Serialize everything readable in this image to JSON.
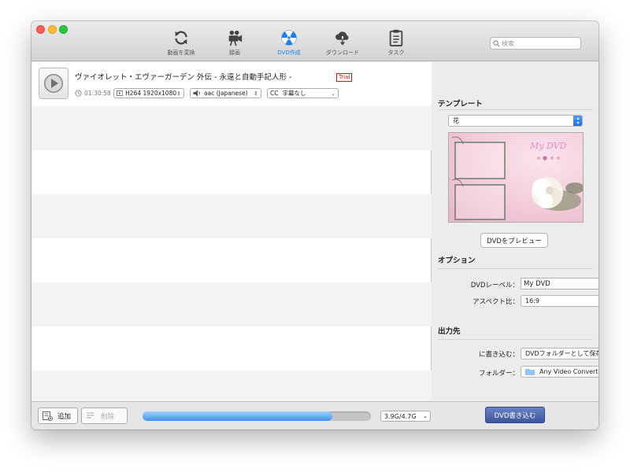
{
  "toolbar": {
    "items": [
      {
        "label": "動画を変換",
        "icon": "convert-icon"
      },
      {
        "label": "録画",
        "icon": "video-camera-icon"
      },
      {
        "label": "DVD作成",
        "icon": "radiation-icon"
      },
      {
        "label": "ダウンロード",
        "icon": "cloud-download-icon"
      },
      {
        "label": "タスク",
        "icon": "clipboard-icon"
      }
    ],
    "active_color": "#1f7ff0",
    "search_placeholder": "検索"
  },
  "video": {
    "title": "ヴァイオレット・エヴァーガーデン 外伝 - 永遠と自動手記人形 -",
    "trial_badge": "Trial",
    "duration": "01:30:58",
    "video_track": "H264 1920x1080",
    "audio_track": "aac (Japanese)",
    "subtitle_prefix": "CC",
    "subtitle": "字幕なし"
  },
  "sidebar": {
    "template_title": "テンプレート",
    "template_value": "花",
    "preview_text": "My DVD",
    "preview_button": "DVDをプレビュー",
    "options_title": "オプション",
    "dvd_label_label": "DVDレーベル：",
    "dvd_label_value": "My DVD",
    "aspect_label": "アスペクト比：",
    "aspect_value": "16:9",
    "output_title": "出力先",
    "write_to_label": "に書き込む：",
    "write_to_value": "DVDフォルダーとして保存",
    "folder_label": "フォルダー：",
    "folder_value": "Any Video Converte..."
  },
  "footer": {
    "add_label": "追加",
    "delete_label": "削除",
    "progress_fraction": 0.83,
    "disk_size": "3.9G/4.7G",
    "burn_label": "DVD書き込む"
  }
}
